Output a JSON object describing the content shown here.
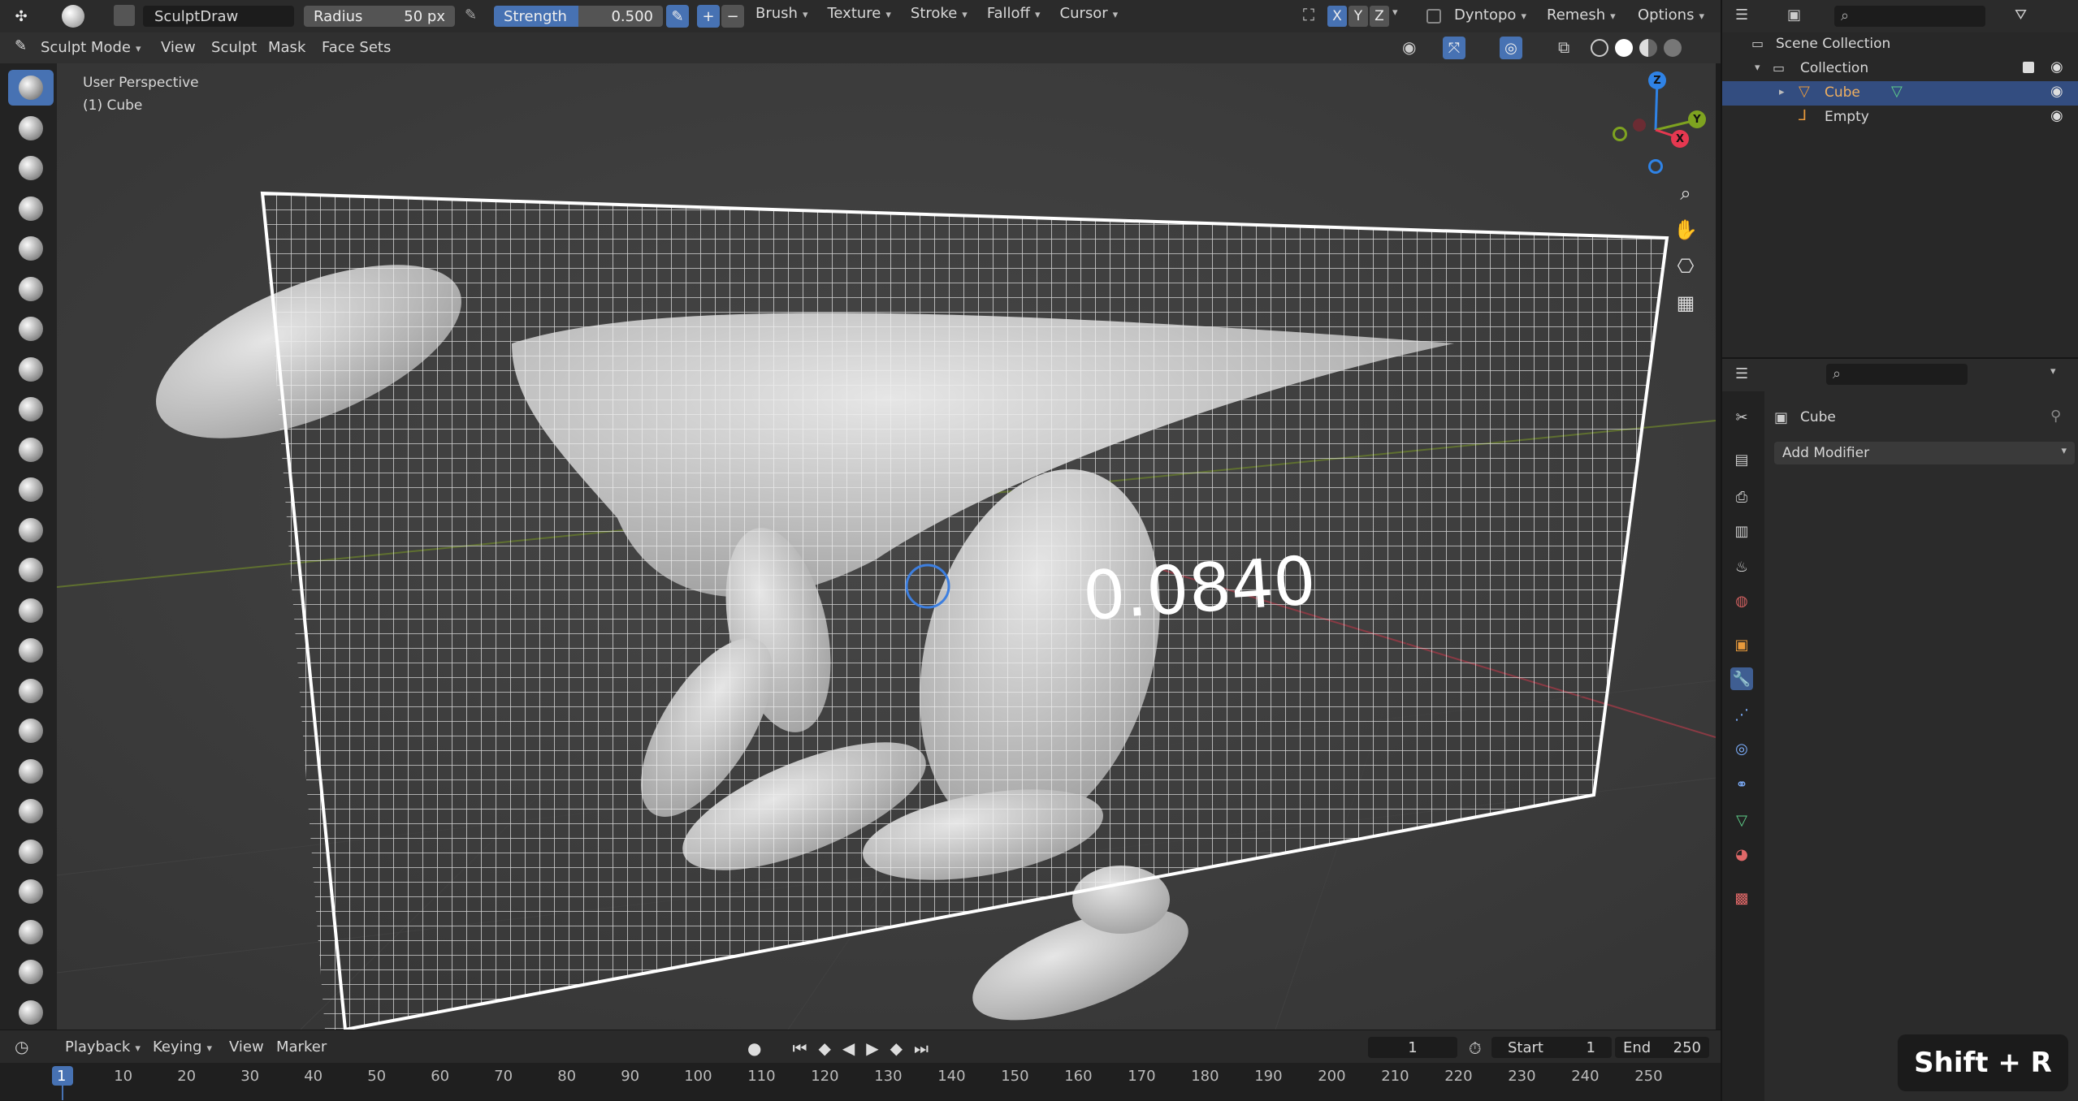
{
  "header": {
    "brush_name": "SculptDraw",
    "radius": {
      "label": "Radius",
      "value": "50 px"
    },
    "strength": {
      "label": "Strength",
      "value": "0.500",
      "fraction": 0.5
    },
    "menus": [
      "Brush",
      "Texture",
      "Stroke",
      "Falloff",
      "Cursor"
    ],
    "axes": [
      "X",
      "Y",
      "Z"
    ],
    "dyntopo": "Dyntopo",
    "remesh": "Remesh",
    "options": "Options"
  },
  "modebar": {
    "mode": "Sculpt Mode",
    "menus": [
      "View",
      "Sculpt",
      "Mask",
      "Face Sets"
    ]
  },
  "viewport": {
    "perspective": "User Perspective",
    "object": "(1) Cube",
    "overlay_value": "0.0840",
    "gizmo": {
      "x": "X",
      "y": "Y",
      "z": "Z"
    }
  },
  "tools": [
    "draw",
    "draw-sharp",
    "clay",
    "clay-strips",
    "clay-thumb",
    "layer",
    "inflate",
    "blob",
    "crease",
    "smooth",
    "flatten",
    "fill",
    "scrape",
    "multiplane-scrape",
    "pinch",
    "grab",
    "elastic-deform",
    "snake-hook",
    "thumb",
    "pose",
    "nudge",
    "rotate",
    "slide-relax",
    "boundary"
  ],
  "timeline": {
    "menus": [
      "Playback",
      "Keying",
      "View",
      "Marker"
    ],
    "current_frame": "1",
    "start_label": "Start",
    "start": "1",
    "end_label": "End",
    "end": "250",
    "ticks": [
      "1",
      "10",
      "20",
      "30",
      "40",
      "50",
      "60",
      "70",
      "80",
      "90",
      "100",
      "110",
      "120",
      "130",
      "140",
      "150",
      "160",
      "170",
      "180",
      "190",
      "200",
      "210",
      "220",
      "230",
      "240",
      "250"
    ]
  },
  "outliner": {
    "scene_collection": "Scene Collection",
    "collection": "Collection",
    "items": [
      "Cube",
      "Empty"
    ]
  },
  "properties": {
    "object_name": "Cube",
    "add_modifier": "Add Modifier"
  },
  "shortcut": "Shift + R",
  "colors": {
    "accent": "#4772b3",
    "selected_row": "#334d80",
    "x_axis": "#e63850",
    "y_axis": "#7ea320",
    "z_axis": "#2f83e6"
  }
}
